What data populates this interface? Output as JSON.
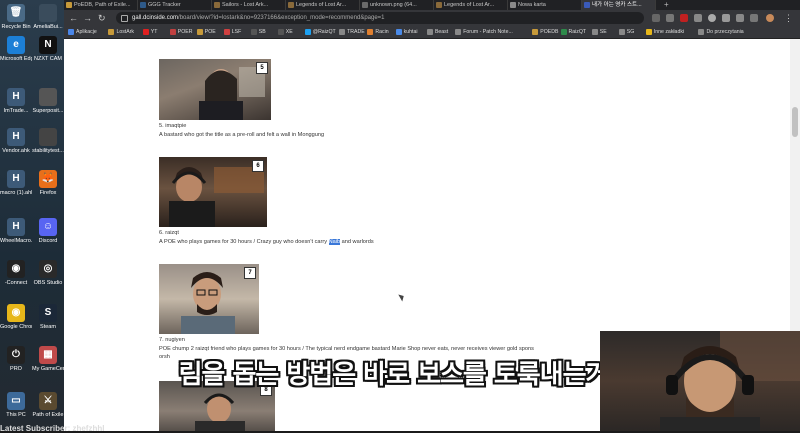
{
  "desktop": {
    "icons": [
      {
        "label": "Recycle Bin",
        "color": "#4a6a86",
        "glyph": "🗑"
      },
      {
        "label": "AmeliaBui...",
        "color": "#3a4c5c",
        "glyph": ""
      },
      {
        "label": "Microsoft Edge",
        "color": "#1c7fd6",
        "glyph": "e"
      },
      {
        "label": "NZXT CAM",
        "color": "#111111",
        "glyph": "N"
      },
      {
        "label": "ImTrade...",
        "color": "#3d5a78",
        "glyph": "H"
      },
      {
        "label": "Superposit...",
        "color": "#555555",
        "glyph": ""
      },
      {
        "label": "Vendor.ahk",
        "color": "#3d5a78",
        "glyph": "H"
      },
      {
        "label": "stabilitytest...",
        "color": "#444444",
        "glyph": ""
      },
      {
        "label": "macro (1).ahk",
        "color": "#3d5a78",
        "glyph": "H"
      },
      {
        "label": "Firefox",
        "color": "#e86f1a",
        "glyph": "🦊"
      },
      {
        "label": "WheelMacro...",
        "color": "#3d5a78",
        "glyph": "H"
      },
      {
        "label": "Discord",
        "color": "#5865f2",
        "glyph": "☺"
      },
      {
        "label": "-Connect",
        "color": "#222222",
        "glyph": "◉"
      },
      {
        "label": "OBS Studio",
        "color": "#2a2a2a",
        "glyph": "◎"
      },
      {
        "label": "Google Chrome",
        "color": "#e7b71a",
        "glyph": "◉"
      },
      {
        "label": "Steam",
        "color": "#1b2838",
        "glyph": "S"
      },
      {
        "label": "PRO",
        "color": "#222222",
        "glyph": "⏻"
      },
      {
        "label": "My GameCenter",
        "color": "#c04a4a",
        "glyph": "▦"
      },
      {
        "label": "This PC",
        "color": "#3d6a9a",
        "glyph": "▭"
      },
      {
        "label": "Path of Exile",
        "color": "#5a4a30",
        "glyph": "⚔"
      }
    ]
  },
  "browser": {
    "tabs": [
      {
        "label": "PoEDB, Path of Exile...",
        "color": "#c79a3a"
      },
      {
        "label": "GGG Tracker",
        "color": "#2e5a8a"
      },
      {
        "label": "Sailors - Lost Ark...",
        "color": "#8a6a3a"
      },
      {
        "label": "Legends of Lost Ar...",
        "color": "#8a6a3a"
      },
      {
        "label": "unknown.png (64...",
        "color": "#6a6a6a"
      },
      {
        "label": "Legends of Lost Ar...",
        "color": "#8a6a3a"
      },
      {
        "label": "Nowa karta",
        "color": "#8a8a8a"
      },
      {
        "label": "내가 아는 영카 스트...",
        "color": "#3a5ab8"
      }
    ],
    "url_domain": "gall.dcinside.com",
    "url_path": "/board/view/?id=lostark&no=9237166&exception_mode=recommend&page=1",
    "bookmarks": [
      {
        "label": "Aplikacje",
        "color": "#4a86e8"
      },
      {
        "label": "LostArk",
        "color": "#c79a3a"
      },
      {
        "label": "YT",
        "color": "#e02020"
      },
      {
        "label": "POER",
        "color": "#c04040"
      },
      {
        "label": "POE",
        "color": "#c79a3a"
      },
      {
        "label": "LSF",
        "color": "#d04040"
      },
      {
        "label": "SB",
        "color": "#555555"
      },
      {
        "label": "XE",
        "color": "#555555"
      },
      {
        "label": "@RaizQT",
        "color": "#1da1f2"
      },
      {
        "label": "TRADE",
        "color": "#888888"
      },
      {
        "label": "Racin",
        "color": "#e08030"
      },
      {
        "label": "kuhtai",
        "color": "#4a8ae8"
      },
      {
        "label": "Beast",
        "color": "#888888"
      },
      {
        "label": "Forum - Patch Note...",
        "color": "#888888"
      },
      {
        "label": "POEDB",
        "color": "#c79a3a"
      },
      {
        "label": "RaizQT",
        "color": "#2e8a4a"
      },
      {
        "label": "SE",
        "color": "#888888"
      },
      {
        "label": "SG",
        "color": "#888888"
      },
      {
        "label": "Inne zakładki",
        "color": "#e7b71a"
      },
      {
        "label": "Do przeczytania",
        "color": "#888888"
      }
    ]
  },
  "entries": [
    {
      "rank": "5",
      "name": "5. imaqtpie",
      "text": "A bastard who got the title as a pre-roll and felt a wall in Monggung"
    },
    {
      "rank": "6",
      "name": "6. raizqt",
      "text_before": "A POE who plays games for 30 hours / Crazy guy who doesn't carry ",
      "text_highlight": "Naib",
      "text_after": " and warlords"
    },
    {
      "rank": "7",
      "name": "7. nugiyen",
      "text": "POE chump 2 raizqt friend who plays games for 30 hours / The typical nerd endgame bastard Marie Shop never eats, never receives viewer gold spons",
      "text2": "orsh"
    },
    {
      "rank": "8"
    }
  ],
  "overlay": {
    "subtitle": "림을 돕는 방법은 바로 보스를 토룩내는거야",
    "ticker": "Latest Subscriber: zhefzhhl"
  }
}
